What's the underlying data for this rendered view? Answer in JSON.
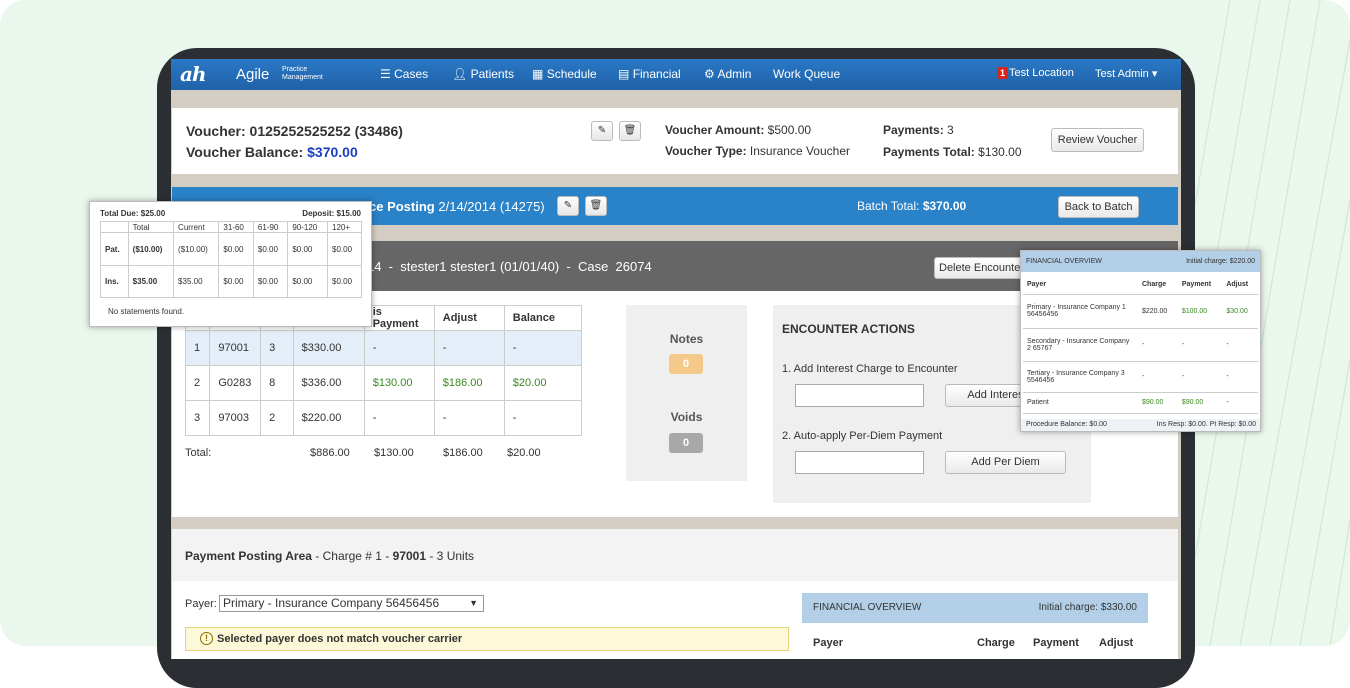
{
  "nav": {
    "logo": "ah",
    "brand": "Agile",
    "brand_sub_1": "Practice",
    "brand_sub_2": "Management",
    "items": [
      {
        "icon": "list-icon",
        "label": "Cases"
      },
      {
        "icon": "user-icon",
        "label": "Patients"
      },
      {
        "icon": "calendar-icon",
        "label": "Schedule"
      },
      {
        "icon": "chart-icon",
        "label": "Financial"
      },
      {
        "icon": "gears-icon",
        "label": "Admin"
      },
      {
        "label": "Work Queue"
      }
    ],
    "notification_count": "1",
    "location": "Test Location",
    "user": "Test Admin"
  },
  "voucher": {
    "title": "Voucher: 0125252525252 (33486)",
    "balance_label": "Voucher Balance:",
    "balance": "$370.00",
    "amount_label": "Voucher Amount:",
    "amount": "$500.00",
    "type_label": "Voucher Type:",
    "type": "Insurance Voucher",
    "payments_label": "Payments:",
    "payments": "3",
    "payments_total_label": "Payments Total:",
    "payments_total": "$130.00",
    "review_button": "Review Voucher"
  },
  "batch": {
    "title": "ce Posting",
    "date_id": "2/14/2014 (14275)",
    "total_label": "Batch Total:",
    "total": "$370.00",
    "back_button": "Back to Batch"
  },
  "encounter": {
    "header": "14  -  stester1 stester1 (01/01/40)  -  Case  26074",
    "delete_button": "Delete Encounter"
  },
  "charges": {
    "headers": [
      "is Payment",
      "Adjust",
      "Balance"
    ],
    "rows": [
      {
        "num": "1",
        "code": "97001",
        "units": "3",
        "amount": "$330.00",
        "payment": "-",
        "adjust": "-",
        "balance": "-"
      },
      {
        "num": "2",
        "code": "G0283",
        "units": "8",
        "amount": "$336.00",
        "payment": "$130.00",
        "adjust": "$186.00",
        "balance": "$20.00"
      },
      {
        "num": "3",
        "code": "97003",
        "units": "2",
        "amount": "$220.00",
        "payment": "-",
        "adjust": "-",
        "balance": "-"
      }
    ],
    "total_label": "Total:",
    "totals": {
      "amount": "$886.00",
      "payment": "$130.00",
      "adjust": "$186.00",
      "balance": "$20.00"
    }
  },
  "notes": {
    "label": "Notes",
    "count": "0",
    "voids_label": "Voids",
    "voids_count": "0"
  },
  "actions": {
    "title": "ENCOUNTER ACTIONS",
    "item1": "1. Add Interest Charge to Encounter",
    "item1_button": "Add Interest C",
    "item2": "2. Auto-apply Per-Diem Payment",
    "item2_button": "Add Per Diem"
  },
  "posting": {
    "title": "Payment Posting Area",
    "subtitle_pre": " - Charge # 1 - ",
    "code": "97001",
    "subtitle_post": " - 3 Units",
    "payer_label": "Payer:",
    "payer_value": "Primary - Insurance Company 56456456",
    "warning": "Selected payer does not match voucher carrier",
    "fo_title": "FINANCIAL OVERVIEW",
    "fo_initial": "Initial charge: $330.00",
    "fo_headers": [
      "Payer",
      "Charge",
      "Payment",
      "Adjust"
    ]
  },
  "aging_popup": {
    "total_due": "Total Due: $25.00",
    "deposit": "Deposit: $15.00",
    "headers": [
      "",
      "Total",
      "Current",
      "31-60",
      "61-90",
      "90-120",
      "120+"
    ],
    "rows": [
      [
        "Pat.",
        "($10.00)",
        "($10.00)",
        "$0.00",
        "$0.00",
        "$0.00",
        "$0.00"
      ],
      [
        "Ins.",
        "$35.00",
        "$35.00",
        "$0.00",
        "$0.00",
        "$0.00",
        "$0.00"
      ]
    ],
    "footer": "No statements found."
  },
  "fo_popup": {
    "title": "FINANCIAL OVERVIEW",
    "initial": "Initial charge: $220.00",
    "headers": [
      "Payer",
      "Charge",
      "Payment",
      "Adjust"
    ],
    "rows": [
      {
        "payer": "Primary - Insurance Company 1 56456456",
        "charge": "$220.00",
        "payment": "$100.00",
        "adjust": "$30.00"
      },
      {
        "payer": "Secondary - Insurance Company 2 65767",
        "charge": "-",
        "payment": "-",
        "adjust": "-"
      },
      {
        "payer": "Tertiary - Insurance Company 3 5546456",
        "charge": "-",
        "payment": "-",
        "adjust": "-"
      },
      {
        "payer": "Patient",
        "charge": "$90.00",
        "payment": "$90.00",
        "adjust": "-"
      }
    ],
    "footer_left": "Procedure Balance: $0.00",
    "footer_right": "Ins Resp: $0.00. Pt Resp: $0.00"
  },
  "colors": {
    "nav": "#1f62a8",
    "blue_bar": "#2a82c9",
    "dark_bar": "#666666",
    "green": "#3a8a22",
    "notes_badge": "#f4c98a",
    "voids_badge": "#a8a8a8"
  }
}
